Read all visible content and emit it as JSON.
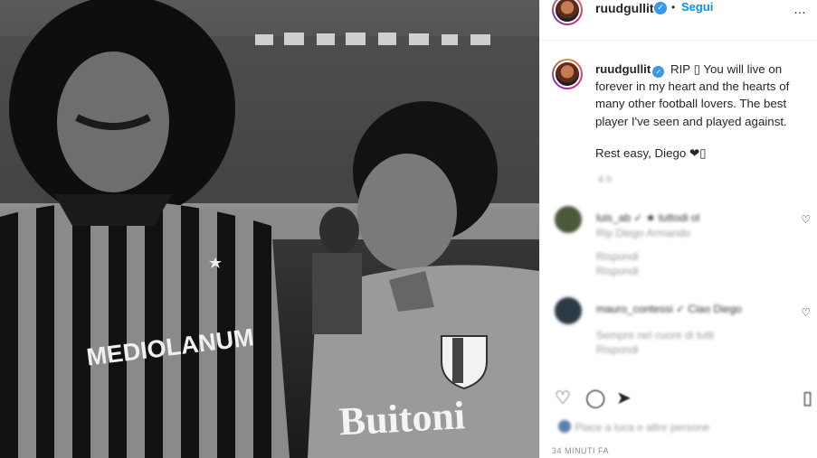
{
  "post": {
    "username": "ruudgullit",
    "separator": "•",
    "follow_label": "Segui",
    "more_label": "…",
    "verified_glyph": "✓"
  },
  "caption": {
    "username": "ruudgullit",
    "text": "RIP ▯ You will live on forever in my heart and the hearts of many other football lovers. The best player I've seen and played against.",
    "text2": "Rest easy, Diego ❤▯",
    "time_blurred": "4 h"
  },
  "comments": [
    {
      "user_blurred": "luis_ab ✓ ★ tuttodi ol",
      "line1_blurred": "Rip Diego Armando",
      "line2_blurred": "Rispondi",
      "avatar_color": "#4a5a3a"
    },
    {
      "user_blurred": "mauro_contessi ✓ Ciao Diego",
      "line1_blurred": "Sempre nel cuore di tutti",
      "line2_blurred": "Rispondi",
      "avatar_color": "#2c3a46"
    }
  ],
  "actions": {
    "like_icon": "heart-icon",
    "comment_icon": "comment-icon",
    "share_icon": "share-icon",
    "save_icon": "bookmark-icon"
  },
  "likes_blurred": "Piace a luca e altre persone",
  "post_time": "34 MINUTI FA",
  "photo": {
    "shirt_left_text": "MEDIOLANUM",
    "shirt_right_text": "Buitoni"
  }
}
